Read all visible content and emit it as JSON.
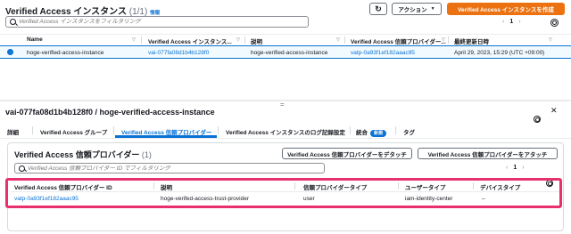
{
  "header": {
    "title": "Verified Access インスタンス",
    "count": "(1/1)",
    "info_label": "情報",
    "refresh_icon": "refresh-icon",
    "action_label": "アクション",
    "create_label": "Verified Access インスタンスを作成"
  },
  "search": {
    "placeholder": "Verified Access インスタンスをフィルタリング"
  },
  "pager": {
    "page": "1"
  },
  "instances_table": {
    "columns": [
      "Name",
      "Verified Access インスタンス...",
      "説明",
      "Verified Access 信頼プロバイダー...",
      "最終更新日時"
    ],
    "rows": [
      {
        "name": "hoge-verified-access-instance",
        "id": "vai-077fa08d1b4b128f0",
        "description": "hoge-verified-access-instance",
        "provider": "vatp-0a93f1ef182aaac95",
        "updated": "April 29, 2023, 15:29 (UTC +09:00)"
      }
    ]
  },
  "resize_handle": "=",
  "detail": {
    "title": "vai-077fa08d1b4b128f0 / hoge-verified-access-instance",
    "tabs": [
      {
        "label": "詳細"
      },
      {
        "label": "Verified Access グループ"
      },
      {
        "label": "Verified Access 信頼プロバイダー"
      },
      {
        "label": "Verified Access インスタンスのログ記録設定"
      },
      {
        "label": "統合",
        "badge": "新規"
      },
      {
        "label": "タグ"
      }
    ]
  },
  "providers_panel": {
    "title": "Verified Access 信頼プロバイダー",
    "count": "(1)",
    "detach_label": "Verified Access 信頼プロバイダーをデタッチ",
    "attach_label": "Verified Access 信頼プロバイダーをアタッチ",
    "search_placeholder": "Verified Access 信頼プロバイダー ID でフィルタリング",
    "page": "1",
    "columns": [
      "Verified Access 信頼プロバイダー ID",
      "説明",
      "信頼プロバイダータイプ",
      "ユーザータイプ",
      "デバイスタイプ"
    ],
    "rows": [
      {
        "id": "vatp-0a93f1ef182aaac95",
        "description": "hoge-verifed-access-trust-provider",
        "type": "user",
        "user_type": "iam-identity-center",
        "device_type": "–"
      }
    ]
  },
  "colors": {
    "link": "#0972d3",
    "primary": "#ec7211",
    "highlight": "#e8306c"
  }
}
